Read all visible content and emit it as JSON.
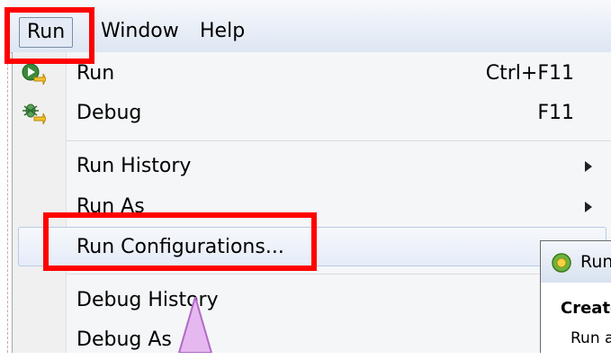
{
  "menubar": {
    "items": [
      {
        "label": "Run"
      },
      {
        "label": "Window"
      },
      {
        "label": "Help"
      }
    ]
  },
  "run_menu": {
    "items": [
      {
        "label": "Run",
        "accel": "Ctrl+F11",
        "icon": "run-icon"
      },
      {
        "label": "Debug",
        "accel": "F11",
        "icon": "debug-icon"
      },
      {
        "label": "Run History",
        "submenu": true
      },
      {
        "label": "Run As",
        "submenu": true
      },
      {
        "label": "Run Configurations...",
        "highlighted": true
      },
      {
        "label": "Debug History"
      },
      {
        "label": "Debug As"
      }
    ]
  },
  "dialog": {
    "title": "Run",
    "heading": "Create",
    "text": "Run a"
  },
  "colors": {
    "annotation": "#ff0000",
    "arrow": "#e6b8f0",
    "menubar": "#dde6f3"
  }
}
